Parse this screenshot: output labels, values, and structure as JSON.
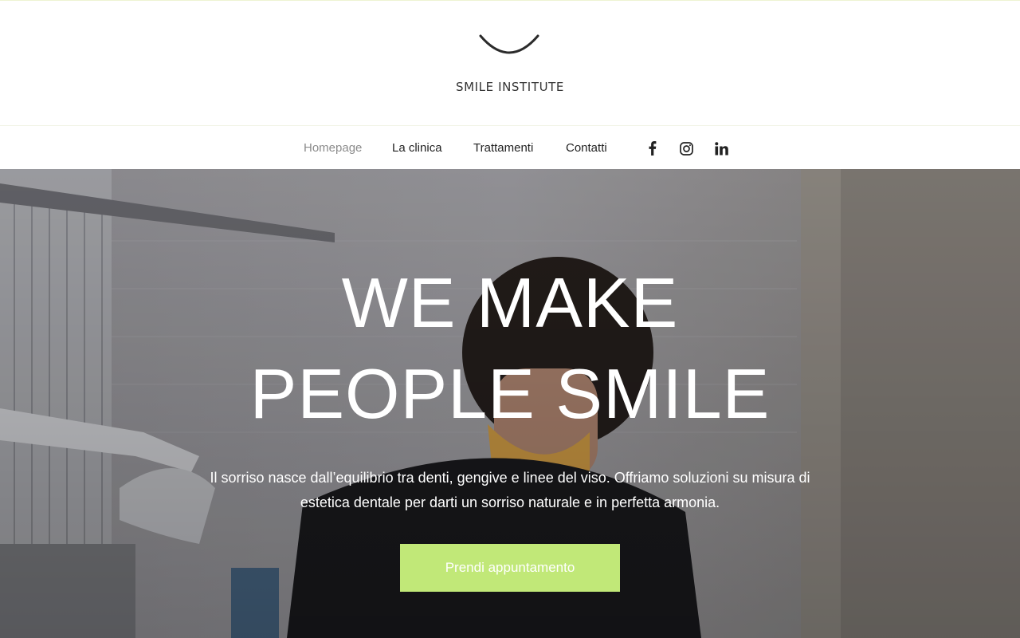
{
  "brand": {
    "name": "SMILE INSTITUTE",
    "logo_icon": "smile-arc-icon"
  },
  "nav": {
    "items": [
      {
        "label": "Homepage",
        "active": true
      },
      {
        "label": "La clinica",
        "active": false
      },
      {
        "label": "Trattamenti",
        "active": false
      },
      {
        "label": "Contatti",
        "active": false
      }
    ],
    "social": [
      {
        "icon": "facebook-icon"
      },
      {
        "icon": "instagram-icon"
      },
      {
        "icon": "linkedin-icon"
      }
    ]
  },
  "hero": {
    "title_line1": "WE MAKE",
    "title_line2": "PEOPLE SMILE",
    "text": "Il sorriso nasce dall’equilibrio tra denti, gengive e linee del viso. Offriamo soluzioni su misura di estetica dentale per darti un sorriso naturale e in perfetta armonia.",
    "cta_label": "Prendi appuntamento"
  },
  "colors": {
    "accent": "#c1e878",
    "nav_active": "#8b8b8b",
    "text_dark": "#222222"
  }
}
